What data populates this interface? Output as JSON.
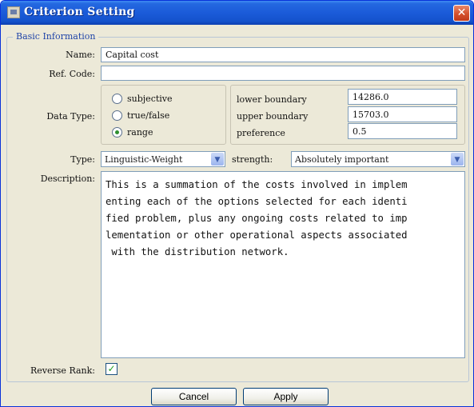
{
  "window": {
    "title": "Criterion Setting"
  },
  "group": {
    "legend": "Basic Information"
  },
  "form": {
    "name_label": "Name:",
    "name_value": "Capital cost",
    "refcode_label": "Ref. Code:",
    "refcode_value": "",
    "datatype_label": "Data Type:",
    "datatype_options": [
      "subjective",
      "true/false",
      "range"
    ],
    "datatype_selected": "range",
    "range": {
      "lower_label": "lower boundary",
      "lower_value": "14286.0",
      "upper_label": "upper boundary",
      "upper_value": "15703.0",
      "preference_label": "preference",
      "preference_value": "0.5"
    },
    "type_label": "Type:",
    "type_value": "Linguistic-Weight",
    "strength_label": "strength:",
    "strength_value": "Absolutely important",
    "description_label": "Description:",
    "description_text": "This is a summation of the costs involved in implem\nenting each of the options selected for each identi\nfied problem, plus any ongoing costs related to imp\nlementation or other operational aspects associated\n with the distribution network.",
    "reverse_rank_label": "Reverse Rank:",
    "reverse_rank_checked": true
  },
  "buttons": {
    "cancel": "Cancel",
    "apply": "Apply"
  },
  "icons": {
    "close": "close-icon",
    "app": "java-app-icon",
    "dropdown": "chevron-down-icon",
    "check": "checkmark-icon"
  }
}
